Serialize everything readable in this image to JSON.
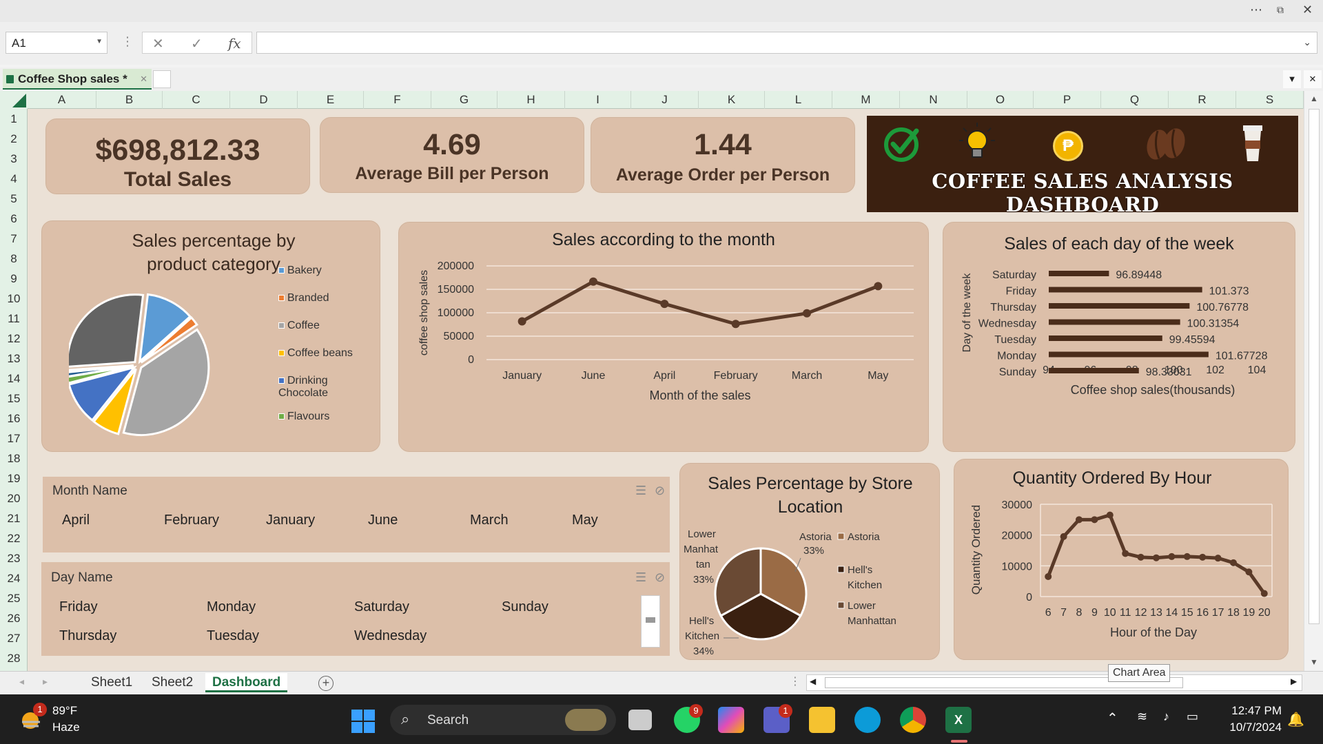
{
  "formula_bar": {
    "name_box": "A1",
    "fx_label": "fx",
    "formula": ""
  },
  "workbook_tab": {
    "title": "Coffee Shop sales *"
  },
  "columns": [
    "A",
    "B",
    "C",
    "D",
    "E",
    "F",
    "G",
    "H",
    "I",
    "J",
    "K",
    "L",
    "M",
    "N",
    "O",
    "P",
    "Q",
    "R",
    "S"
  ],
  "rows": [
    "1",
    "2",
    "3",
    "4",
    "5",
    "6",
    "7",
    "8",
    "9",
    "10",
    "11",
    "12",
    "13",
    "14",
    "15",
    "16",
    "17",
    "18",
    "19",
    "20",
    "21",
    "22",
    "23",
    "24",
    "25",
    "26",
    "27",
    "28"
  ],
  "kpis": {
    "total_sales": {
      "value": "$698,812.33",
      "label": "Total Sales"
    },
    "avg_bill": {
      "value": "4.69",
      "label": "Average Bill per Person"
    },
    "avg_order": {
      "value": "1.44",
      "label": "Average Order per Person"
    }
  },
  "banner": {
    "title": "COFFEE SALES ANALYSIS DASHBOARD",
    "coin_symbol": "₱",
    "colors": {
      "bg": "#3b2010",
      "check": "#1d9a3a",
      "coin": "#f2b400"
    }
  },
  "chart_data": [
    {
      "type": "pie",
      "title": "Sales percentage by product category",
      "legend": [
        "Bakery",
        "Branded",
        "Coffee",
        "Coffee beans",
        "Drinking Chocolate",
        "Flavours"
      ],
      "colors": [
        "#5b9bd5",
        "#ed7d31",
        "#a5a5a5",
        "#ffc000",
        "#4472c4",
        "#70ad47",
        "#255e91",
        "#9e480e",
        "#636363"
      ],
      "values": [
        11.5,
        2.1,
        38.7,
        6.5,
        10.2,
        1.5,
        1.0,
        0.5,
        28.0
      ],
      "legend_position": "right"
    },
    {
      "type": "line",
      "title": "Sales according to the month",
      "categories": [
        "January",
        "June",
        "April",
        "February",
        "March",
        "May"
      ],
      "values": [
        81678,
        166486,
        118941,
        76145,
        98835,
        156728
      ],
      "xlabel": "Month of the sales",
      "ylabel": "coffee shop sales",
      "yticks": [
        "0",
        "50000",
        "100000",
        "150000",
        "200000"
      ],
      "ylim": [
        0,
        200000
      ],
      "color": "#5a3a28",
      "grid": true
    },
    {
      "type": "bar",
      "orientation": "horizontal",
      "title": "Sales of each day of the week",
      "categories": [
        "Saturday",
        "Friday",
        "Thursday",
        "Wednesday",
        "Tuesday",
        "Monday",
        "Sunday"
      ],
      "values": [
        96.89448,
        101.373,
        100.76778,
        100.31354,
        99.45594,
        101.67728,
        98.33031
      ],
      "data_labels": [
        "96.89448",
        "101.373",
        "100.76778",
        "100.31354",
        "99.45594",
        "101.67728",
        "98.33031"
      ],
      "xlabel": "Coffee shop sales(thousands)",
      "ylabel": "Day of the week",
      "xticks": [
        "94",
        "96",
        "98",
        "100",
        "102",
        "104"
      ],
      "xlim": [
        94,
        104
      ],
      "color": "#4a2c1a"
    },
    {
      "type": "pie",
      "title": "Sales Percentage by Store Location",
      "categories": [
        "Astoria",
        "Hell's Kitchen",
        "Lower Manhattan"
      ],
      "values": [
        33,
        34,
        33
      ],
      "data_labels": [
        {
          "name": "Astoria",
          "pct": "33%"
        },
        {
          "name": "Hell's Kitchen",
          "pct": "34%"
        },
        {
          "name": "Lower Manhattan",
          "pct": "33%"
        }
      ],
      "legend": [
        "Astoria",
        "Hell's Kitchen",
        "Lower Manhattan"
      ],
      "colors": [
        "#9a6b45",
        "#3a2010",
        "#6a4a34"
      ],
      "legend_position": "right"
    },
    {
      "type": "line",
      "title": "Quantity Ordered By Hour",
      "categories": [
        "6",
        "7",
        "8",
        "9",
        "10",
        "11",
        "12",
        "13",
        "14",
        "15",
        "16",
        "17",
        "18",
        "19",
        "20"
      ],
      "values": [
        6500,
        19500,
        25000,
        25000,
        26500,
        14000,
        12800,
        12600,
        13000,
        13000,
        12800,
        12500,
        11000,
        8000,
        1000
      ],
      "xlabel": "Hour of the Day",
      "ylabel": "Quantity Ordered",
      "yticks": [
        "0",
        "10000",
        "20000",
        "30000"
      ],
      "ylim": [
        0,
        30000
      ],
      "color": "#5a3a28",
      "grid": true
    }
  ],
  "slicers": {
    "month": {
      "header": "Month Name",
      "items": [
        "April",
        "February",
        "January",
        "June",
        "March",
        "May"
      ]
    },
    "day": {
      "header": "Day Name",
      "items": [
        "Friday",
        "Monday",
        "Saturday",
        "Sunday",
        "Thursday",
        "Tuesday",
        "Wednesday"
      ]
    }
  },
  "sheet_tabs": [
    "Sheet1",
    "Sheet2",
    "Dashboard"
  ],
  "active_sheet": "Dashboard",
  "tooltip": "Chart Area",
  "taskbar": {
    "weather_temp": "89°F",
    "weather_desc": "Haze",
    "weather_badge": "1",
    "search_placeholder": "Search",
    "whatsapp_badge": "9",
    "teams_badge": "1",
    "time": "12:47 PM",
    "date": "10/7/2024"
  }
}
